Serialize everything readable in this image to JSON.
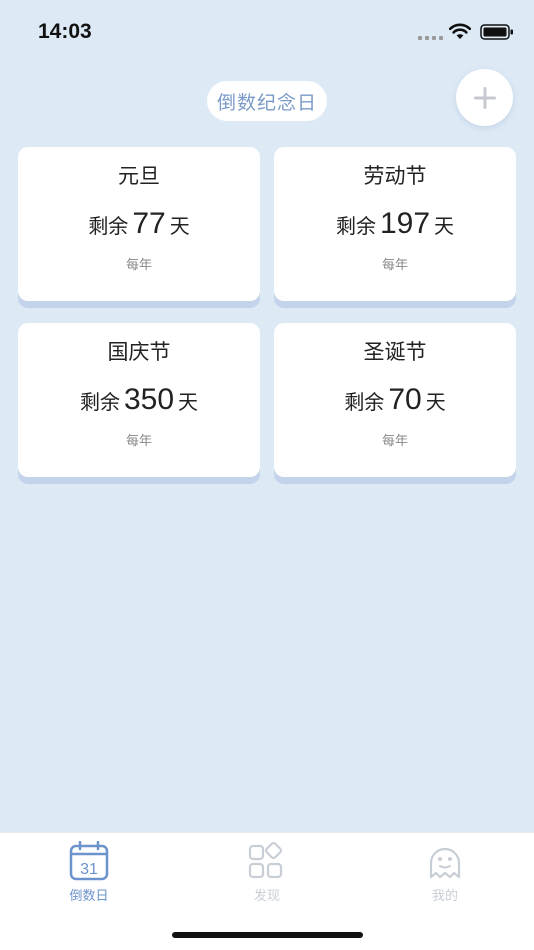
{
  "status_bar": {
    "time": "14:03"
  },
  "header": {
    "title": "倒数纪念日",
    "add_icon": "plus-icon"
  },
  "cards": [
    {
      "name": "元旦",
      "prefix": "剩余",
      "days": "77",
      "suffix": "天",
      "repeat": "每年"
    },
    {
      "name": "劳动节",
      "prefix": "剩余",
      "days": "197",
      "suffix": "天",
      "repeat": "每年"
    },
    {
      "name": "国庆节",
      "prefix": "剩余",
      "days": "350",
      "suffix": "天",
      "repeat": "每年"
    },
    {
      "name": "圣诞节",
      "prefix": "剩余",
      "days": "70",
      "suffix": "天",
      "repeat": "每年"
    }
  ],
  "tabs": [
    {
      "label": "倒数日",
      "icon": "calendar-icon",
      "icon_text": "31",
      "active": true
    },
    {
      "label": "发现",
      "icon": "grid-icon",
      "active": false
    },
    {
      "label": "我的",
      "icon": "ghost-profile-icon",
      "active": false
    }
  ],
  "colors": {
    "background": "#dde9f5",
    "accent": "#6b93cc",
    "inactive": "#c8ced6",
    "card_shadow": "#c3d3ea"
  }
}
